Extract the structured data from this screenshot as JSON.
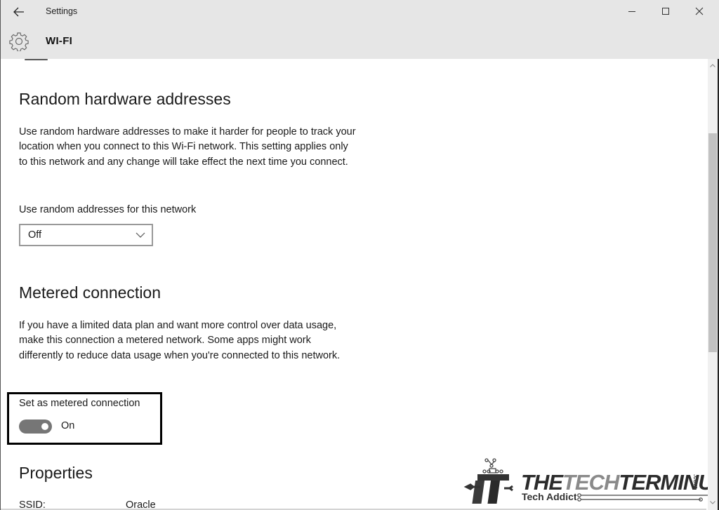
{
  "window": {
    "app_title": "Settings",
    "controls": {
      "back_icon": "arrow-left-icon",
      "minimize_icon": "minimize-icon",
      "maximize_icon": "maximize-icon",
      "close_icon": "close-icon"
    }
  },
  "header": {
    "icon": "gear-icon",
    "page_title": "WI-FI"
  },
  "sections": {
    "random_hw": {
      "heading": "Random hardware addresses",
      "description": "Use random hardware addresses to make it harder for people to track your location when you connect to this Wi-Fi network. This setting applies only to this network and any change will take effect the next time you connect.",
      "dropdown_label": "Use random addresses for this network",
      "dropdown_value": "Off"
    },
    "metered": {
      "heading": "Metered connection",
      "description": "If you have a limited data plan and want more control over data usage, make this connection a metered network. Some apps might work differently to reduce data usage when you're connected to this network.",
      "toggle_label": "Set as metered connection",
      "toggle_state": "On",
      "toggle_on": true
    },
    "properties": {
      "heading": "Properties",
      "rows": [
        {
          "key": "SSID:",
          "value": "Oracle"
        }
      ]
    }
  },
  "watermark": {
    "brand_part1": "THE",
    "brand_part2": "TECH",
    "brand_part3": "TERMINUS",
    "domain_suffix": ".com",
    "tagline": "Tech Addict"
  },
  "colors": {
    "header_bg": "#e6e6e6",
    "toggle_fill": "#767676",
    "highlight_border": "#000000",
    "scroll_thumb": "#c2c2c2"
  }
}
